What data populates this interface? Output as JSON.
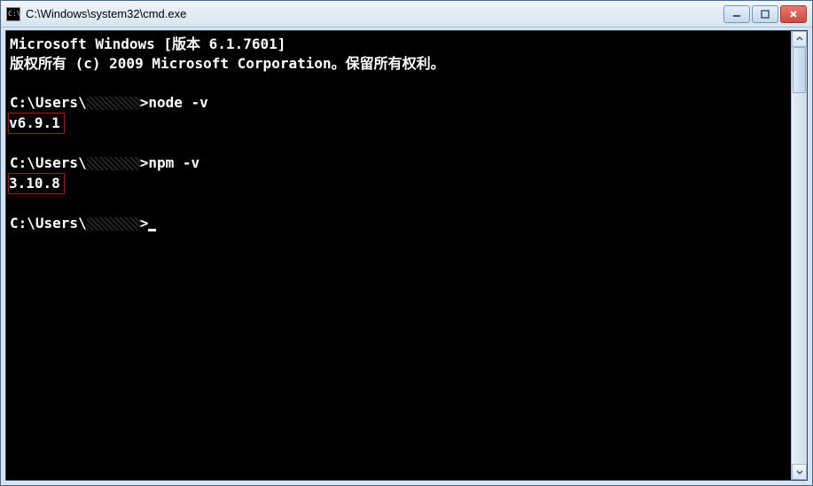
{
  "window": {
    "title": "C:\\Windows\\system32\\cmd.exe",
    "icon_label": "C:\\"
  },
  "terminal": {
    "banner_line1": "Microsoft Windows [版本 6.1.7601]",
    "banner_line2": "版权所有 (c) 2009 Microsoft Corporation。保留所有权利。",
    "prompt_prefix": "C:\\Users\\",
    "prompt_suffix": ">",
    "cmd1": "node -v",
    "out1": "v6.9.1",
    "cmd2": "npm -v",
    "out2": "3.10.8"
  }
}
